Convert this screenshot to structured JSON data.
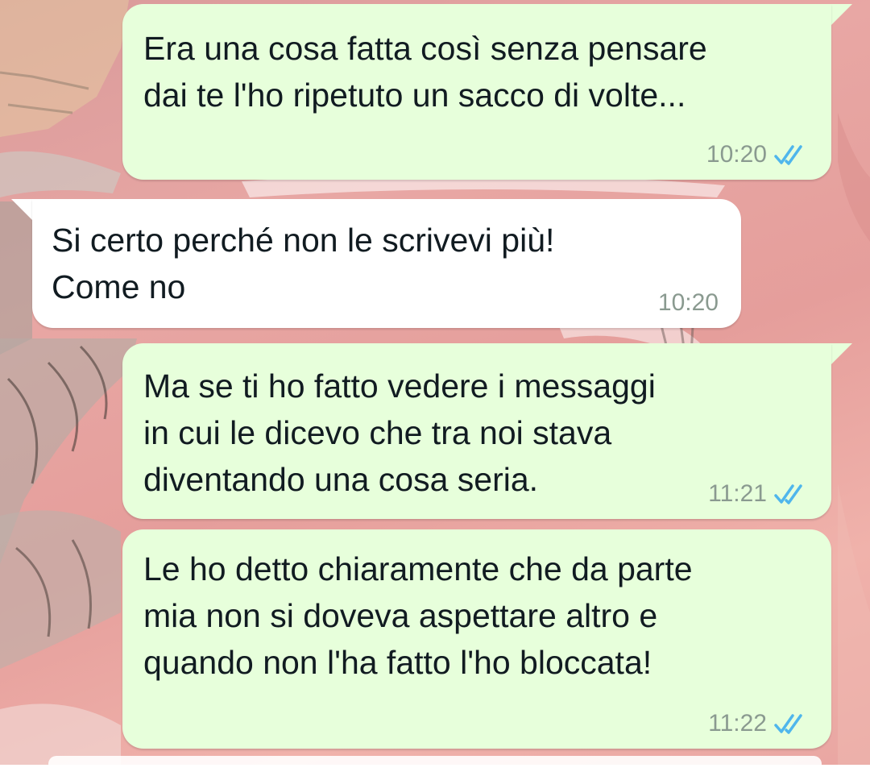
{
  "colors": {
    "outgoing_bubble": "#e7ffdb",
    "incoming_bubble": "#ffffff",
    "read_ticks": "#4fb6ec",
    "wallpaper": "#e8a7a4"
  },
  "messages": [
    {
      "direction": "outgoing",
      "text": "Era una cosa fatta così senza pensare\ndai te l'ho ripetuto un sacco di volte...",
      "time": "10:20",
      "status_icon": "double-check-read-icon"
    },
    {
      "direction": "incoming",
      "text": "Si certo perché non le scrivevi più!\nCome no",
      "time": "10:20"
    },
    {
      "direction": "outgoing",
      "text": "Ma se ti ho fatto vedere i messaggi\nin cui le dicevo che tra noi stava\ndiventando una cosa seria.",
      "time": "11:21",
      "status_icon": "double-check-read-icon"
    },
    {
      "direction": "outgoing",
      "text": "Le ho detto chiaramente che da parte\nmia non si doveva aspettare altro e\nquando non l'ha fatto l'ho bloccata!",
      "time": "11:22",
      "status_icon": "double-check-read-icon"
    }
  ]
}
